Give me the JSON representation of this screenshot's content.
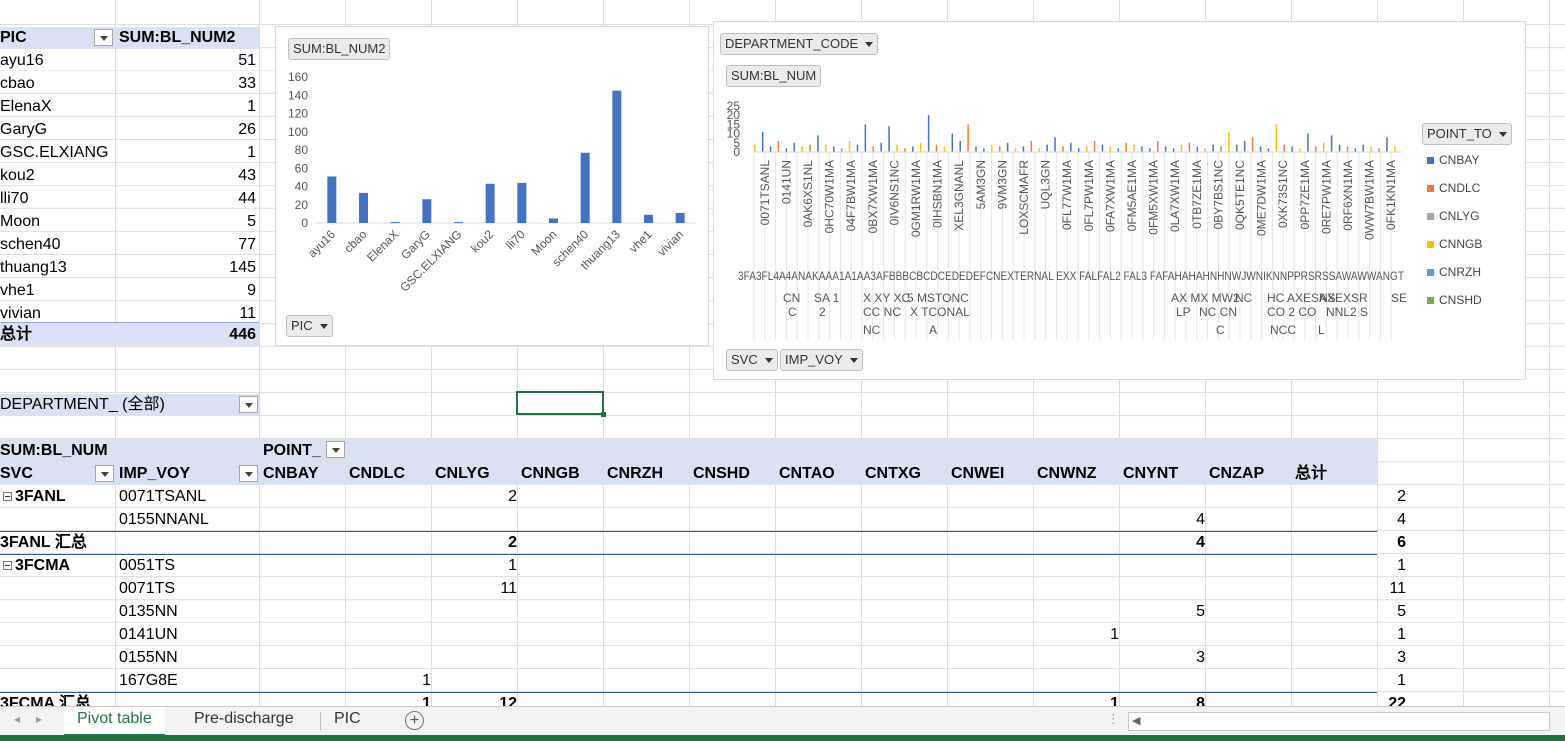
{
  "summary_table": {
    "header_pic": "PIC",
    "header_sum": "SUM:BL_NUM2",
    "rows": [
      {
        "pic": "ayu16",
        "value": "51"
      },
      {
        "pic": "cbao",
        "value": "33"
      },
      {
        "pic": "ElenaX",
        "value": "1"
      },
      {
        "pic": "GaryG",
        "value": "26"
      },
      {
        "pic": "GSC.ELXIANG",
        "value": "1"
      },
      {
        "pic": "kou2",
        "value": "43"
      },
      {
        "pic": "lli70",
        "value": "44"
      },
      {
        "pic": "Moon",
        "value": "5"
      },
      {
        "pic": "schen40",
        "value": "77"
      },
      {
        "pic": "thuang13",
        "value": "145"
      },
      {
        "pic": "vhe1",
        "value": "9"
      },
      {
        "pic": "vivian",
        "value": "11"
      }
    ],
    "total_label": "总计",
    "total_value": "446"
  },
  "chart_data": [
    {
      "type": "bar",
      "field_button": "SUM:BL_NUM2",
      "axis_button": "PIC",
      "categories": [
        "ayu16",
        "cbao",
        "ElenaX",
        "GaryG",
        "GSC.ELXIANG",
        "kou2",
        "lli70",
        "Moon",
        "schen40",
        "thuang13",
        "vhe1",
        "vivian"
      ],
      "values": [
        51,
        33,
        1,
        26,
        1,
        43,
        44,
        5,
        77,
        145,
        9,
        11
      ],
      "ylim": [
        0,
        160
      ],
      "yticks": [
        "0",
        "20",
        "40",
        "60",
        "80",
        "100",
        "120",
        "140",
        "160"
      ],
      "color": "#4472c4"
    },
    {
      "type": "bar",
      "filter_button": "DEPARTMENT_CODE",
      "field_button": "SUM:BL_NUM",
      "legend_button": "POINT_TO",
      "row_buttons": [
        "SVC",
        "IMP_VOY"
      ],
      "yticks": [
        "0",
        "5",
        "10",
        "15",
        "20",
        "25"
      ],
      "ylim": [
        0,
        25
      ],
      "voy_labels": [
        "0071TSANL",
        "0141UN",
        "0AK6XS1NL",
        "0HC70W1MA",
        "04F7BW1MA",
        "0BX7XW1MA",
        "0IV6NS1NC",
        "0GM1RW1MA",
        "0IHSBN1MA",
        "XEL3GNANL",
        "5AM3GN",
        "9VM3GN",
        "LOXSCMAFR",
        "UQL3GN",
        "0FL77W1MA",
        "0FL7PW1MA",
        "0FA7XW1MA",
        "0FM5AE1MA",
        "0FM5XW1MA",
        "0LA7XW1MA",
        "0TB7ZE1MA",
        "0BY7BS1NC",
        "0QK5TE1NC",
        "0ME7DW1MA",
        "0XK73S1NC",
        "0PP7ZE1MA",
        "0RE7PW1MA",
        "0RF6XN1MA",
        "0WW7BW1MA",
        "0FK1KN1MA"
      ],
      "svc_line1": "3FA3FL4A4ANAKAAA1A1AA3AFBBBCBCDCEDEDEFCNEXTERNAL EXX FALFAL2 FAL3 FAFAHAHAHNHNWJWNIKNNPPRSRSSAWAWWANGT",
      "svc_line2_items": [
        {
          "text": "CN",
          "x": 782
        },
        {
          "text": "SA 1",
          "x": 813
        },
        {
          "text": "X XY XC",
          "x": 862
        },
        {
          "text": "5 MSTONC",
          "x": 906
        },
        {
          "text": "AX MX MW2",
          "x": 1170
        },
        {
          "text": "NC",
          "x": 1234
        },
        {
          "text": "HC AXESNS",
          "x": 1266
        },
        {
          "text": "AXEXSR",
          "x": 1318
        },
        {
          "text": "SE",
          "x": 1390
        }
      ],
      "svc_line3_items": [
        {
          "text": "C",
          "x": 787
        },
        {
          "text": "2",
          "x": 818
        },
        {
          "text": "CC NC",
          "x": 862
        },
        {
          "text": "X TCONAL",
          "x": 909
        },
        {
          "text": "LP",
          "x": 1175
        },
        {
          "text": "NC CN",
          "x": 1198
        },
        {
          "text": "CO 2 CO",
          "x": 1266
        },
        {
          "text": "NNL2 S",
          "x": 1325
        }
      ],
      "svc_line4_items": [
        {
          "text": "NC",
          "x": 862
        },
        {
          "text": "A",
          "x": 928
        },
        {
          "text": "C",
          "x": 1215
        },
        {
          "text": "NCC",
          "x": 1269
        },
        {
          "text": "L",
          "x": 1317
        }
      ],
      "legend": [
        "CNBAY",
        "CNDLC",
        "CNLYG",
        "CNNGB",
        "CNRZH",
        "CNSHD"
      ],
      "legend_colors": [
        "#4472c4",
        "#ed7d31",
        "#a5a5a5",
        "#ffc000",
        "#5b9bd5",
        "#70ad47"
      ]
    }
  ],
  "filter": {
    "label": "DEPARTMENT_",
    "value": "(全部)"
  },
  "pivot": {
    "value_field": "SUM:BL_NUM",
    "column_field": "POINT_",
    "row_fields": [
      "SVC",
      "IMP_VOY"
    ],
    "columns": [
      "CNBAY",
      "CNDLC",
      "CNLYG",
      "CNNGB",
      "CNRZH",
      "CNSHD",
      "CNTAO",
      "CNTXG",
      "CNWEI",
      "CNWNZ",
      "CNYNT",
      "CNZAP",
      "总计"
    ],
    "rows": [
      {
        "svc": "3FANL",
        "voy": "0071TSANL",
        "cells": {
          "CNLYG": "2",
          "总计": "2"
        },
        "group": true
      },
      {
        "svc": "",
        "voy": "0155NNANL",
        "cells": {
          "CNYNT": "4",
          "总计": "4"
        }
      },
      {
        "svc": "3FANL 汇总",
        "voy": "",
        "cells": {
          "CNLYG": "2",
          "CNYNT": "4",
          "总计": "6"
        },
        "subtotal": true
      },
      {
        "svc": "3FCMA",
        "voy": "0051TS",
        "cells": {
          "CNLYG": "1",
          "总计": "1"
        },
        "group": true
      },
      {
        "svc": "",
        "voy": "0071TS",
        "cells": {
          "CNLYG": "11",
          "总计": "11"
        }
      },
      {
        "svc": "",
        "voy": "0135NN",
        "cells": {
          "CNYNT": "5",
          "总计": "5"
        }
      },
      {
        "svc": "",
        "voy": "0141UN",
        "cells": {
          "CNWNZ": "1",
          "总计": "1"
        }
      },
      {
        "svc": "",
        "voy": "0155NN",
        "cells": {
          "CNYNT": "3",
          "总计": "3"
        }
      },
      {
        "svc": "",
        "voy": "167G8E",
        "cells": {
          "CNDLC": "1",
          "总计": "1"
        }
      },
      {
        "svc": "3FCMA 汇总",
        "voy": "",
        "cells": {
          "CNDLC": "1",
          "CNLYG": "12",
          "CNWNZ": "1",
          "CNYNT": "8",
          "总计": "22"
        },
        "subtotal": true
      }
    ]
  },
  "tabs": [
    "Pivot table",
    "Pre-discharge",
    "PIC"
  ],
  "active_tab": "Pivot table"
}
